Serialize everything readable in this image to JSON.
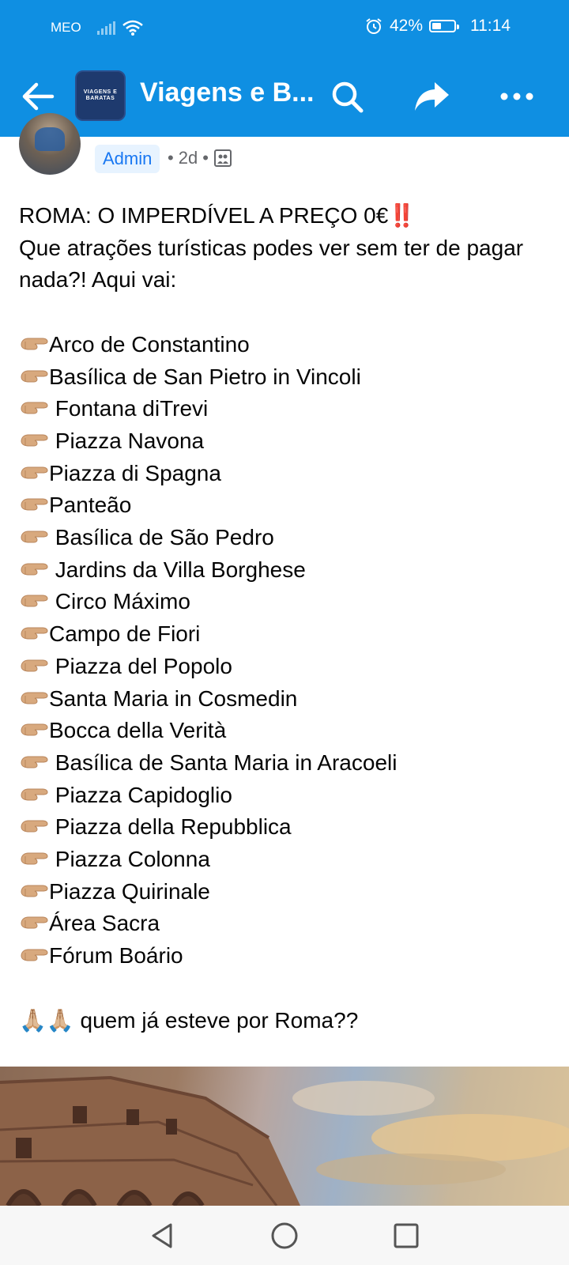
{
  "status_bar": {
    "carrier": "MEO",
    "battery_percent": "42%",
    "battery_level": 0.42,
    "time": "11:14"
  },
  "app_bar": {
    "back_icon": "back-arrow-icon",
    "group_logo_text": "VIAGENS E BARATAS",
    "group_name": "Viagens e B...",
    "actions": [
      "search-icon",
      "share-icon",
      "more-icon"
    ]
  },
  "post": {
    "role_badge": "Admin",
    "age": "2d",
    "separator": "•",
    "audience_icon": "group-icon",
    "headline": "ROMA: O IMPERDÍVEL A PREÇO 0€‼️",
    "intro": "Que atrações turísticas podes ver sem ter de pagar nada?! Aqui vai:",
    "places": [
      "Arco de Constantino",
      "Basílica de San Pietro in Vincoli",
      " Fontana diTrevi",
      " Piazza Navona",
      "Piazza di Spagna",
      "Panteão",
      " Basílica de São Pedro",
      " Jardins da Villa Borghese",
      " Circo Máximo",
      "Campo de Fiori",
      " Piazza del Popolo",
      "Santa Maria in Cosmedin",
      "Bocca della Verità",
      " Basílica de Santa Maria in Aracoeli",
      " Piazza Capidoglio",
      " Piazza della Repubblica",
      " Piazza Colonna",
      "Piazza Quirinale",
      "Área Sacra",
      "Fórum Boário"
    ],
    "closing": " quem já esteve por Roma??",
    "closing_emoji": "🙏🏼🙏🏼"
  },
  "nav_bar": {
    "buttons": [
      "back-triangle-icon",
      "home-circle-icon",
      "recents-square-icon"
    ]
  }
}
